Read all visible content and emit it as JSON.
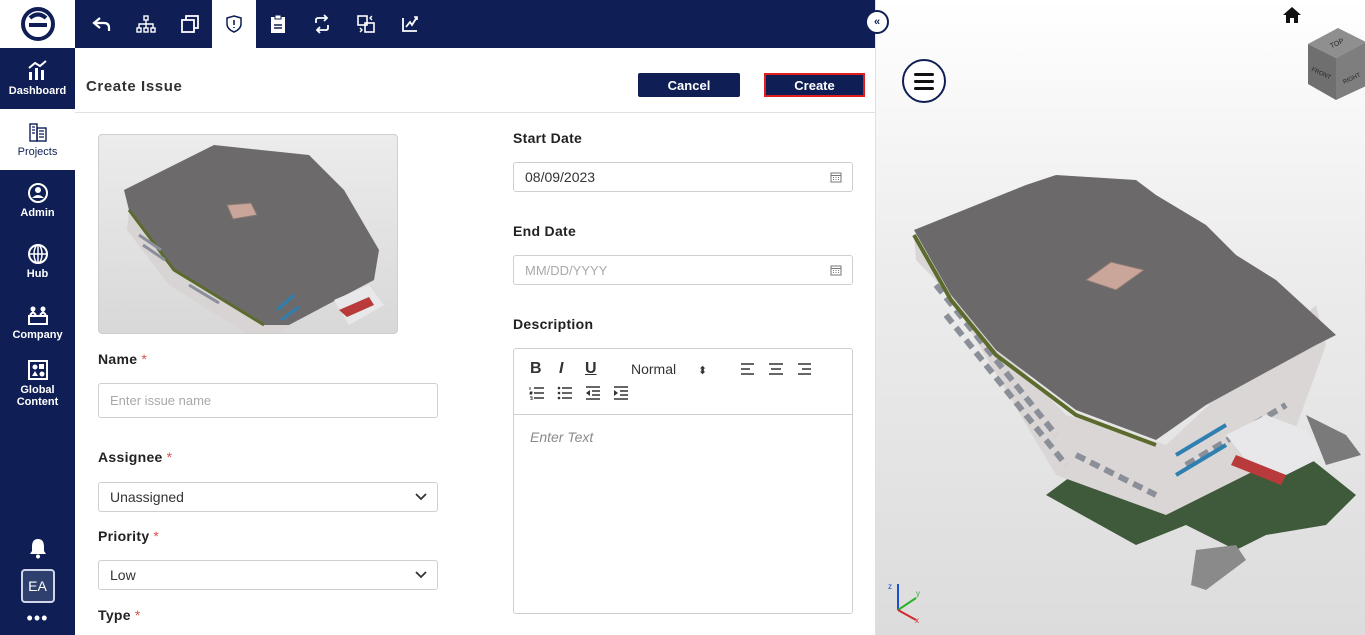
{
  "sidebar": {
    "items": [
      {
        "label": "Dashboard",
        "icon": "dashboard-icon"
      },
      {
        "label": "Projects",
        "icon": "projects-icon"
      },
      {
        "label": "Admin",
        "icon": "admin-icon"
      },
      {
        "label": "Hub",
        "icon": "hub-icon"
      },
      {
        "label": "Company",
        "icon": "company-icon"
      },
      {
        "label": "Global Content",
        "icon": "global-content-icon"
      }
    ],
    "avatar": "EA",
    "more": "•••"
  },
  "toolbar": {
    "tools": [
      "back-icon",
      "hierarchy-icon",
      "copy-icon",
      "issue-icon",
      "rfi-icon",
      "sync-icon",
      "compare-icon",
      "markup-icon"
    ],
    "active_tool": "issue-icon",
    "collapse": "«"
  },
  "form": {
    "title": "Create Issue",
    "cancel_label": "Cancel",
    "create_label": "Create",
    "name_label": "Name",
    "name_placeholder": "Enter issue name",
    "assignee_label": "Assignee",
    "assignee_value": "Unassigned",
    "priority_label": "Priority",
    "priority_value": "Low",
    "type_label": "Type",
    "required_mark": "*",
    "start_date_label": "Start Date",
    "start_date_value": "08/09/2023",
    "end_date_label": "End Date",
    "end_date_placeholder": "MM/DD/YYYY",
    "description_label": "Description",
    "editor": {
      "bold": "B",
      "italic": "I",
      "underline": "U",
      "format_value": "Normal",
      "format_arrow": "⬍",
      "placeholder": "Enter Text"
    }
  },
  "viewer": {
    "cube_faces": {
      "top": "TOP",
      "front": "FRONT",
      "right": "RIGHT"
    },
    "axes": {
      "x": "x",
      "y": "y",
      "z": "z"
    }
  },
  "colors": {
    "navy": "#0f1f55",
    "create_border": "#e01e1e",
    "required": "#d9534f"
  }
}
